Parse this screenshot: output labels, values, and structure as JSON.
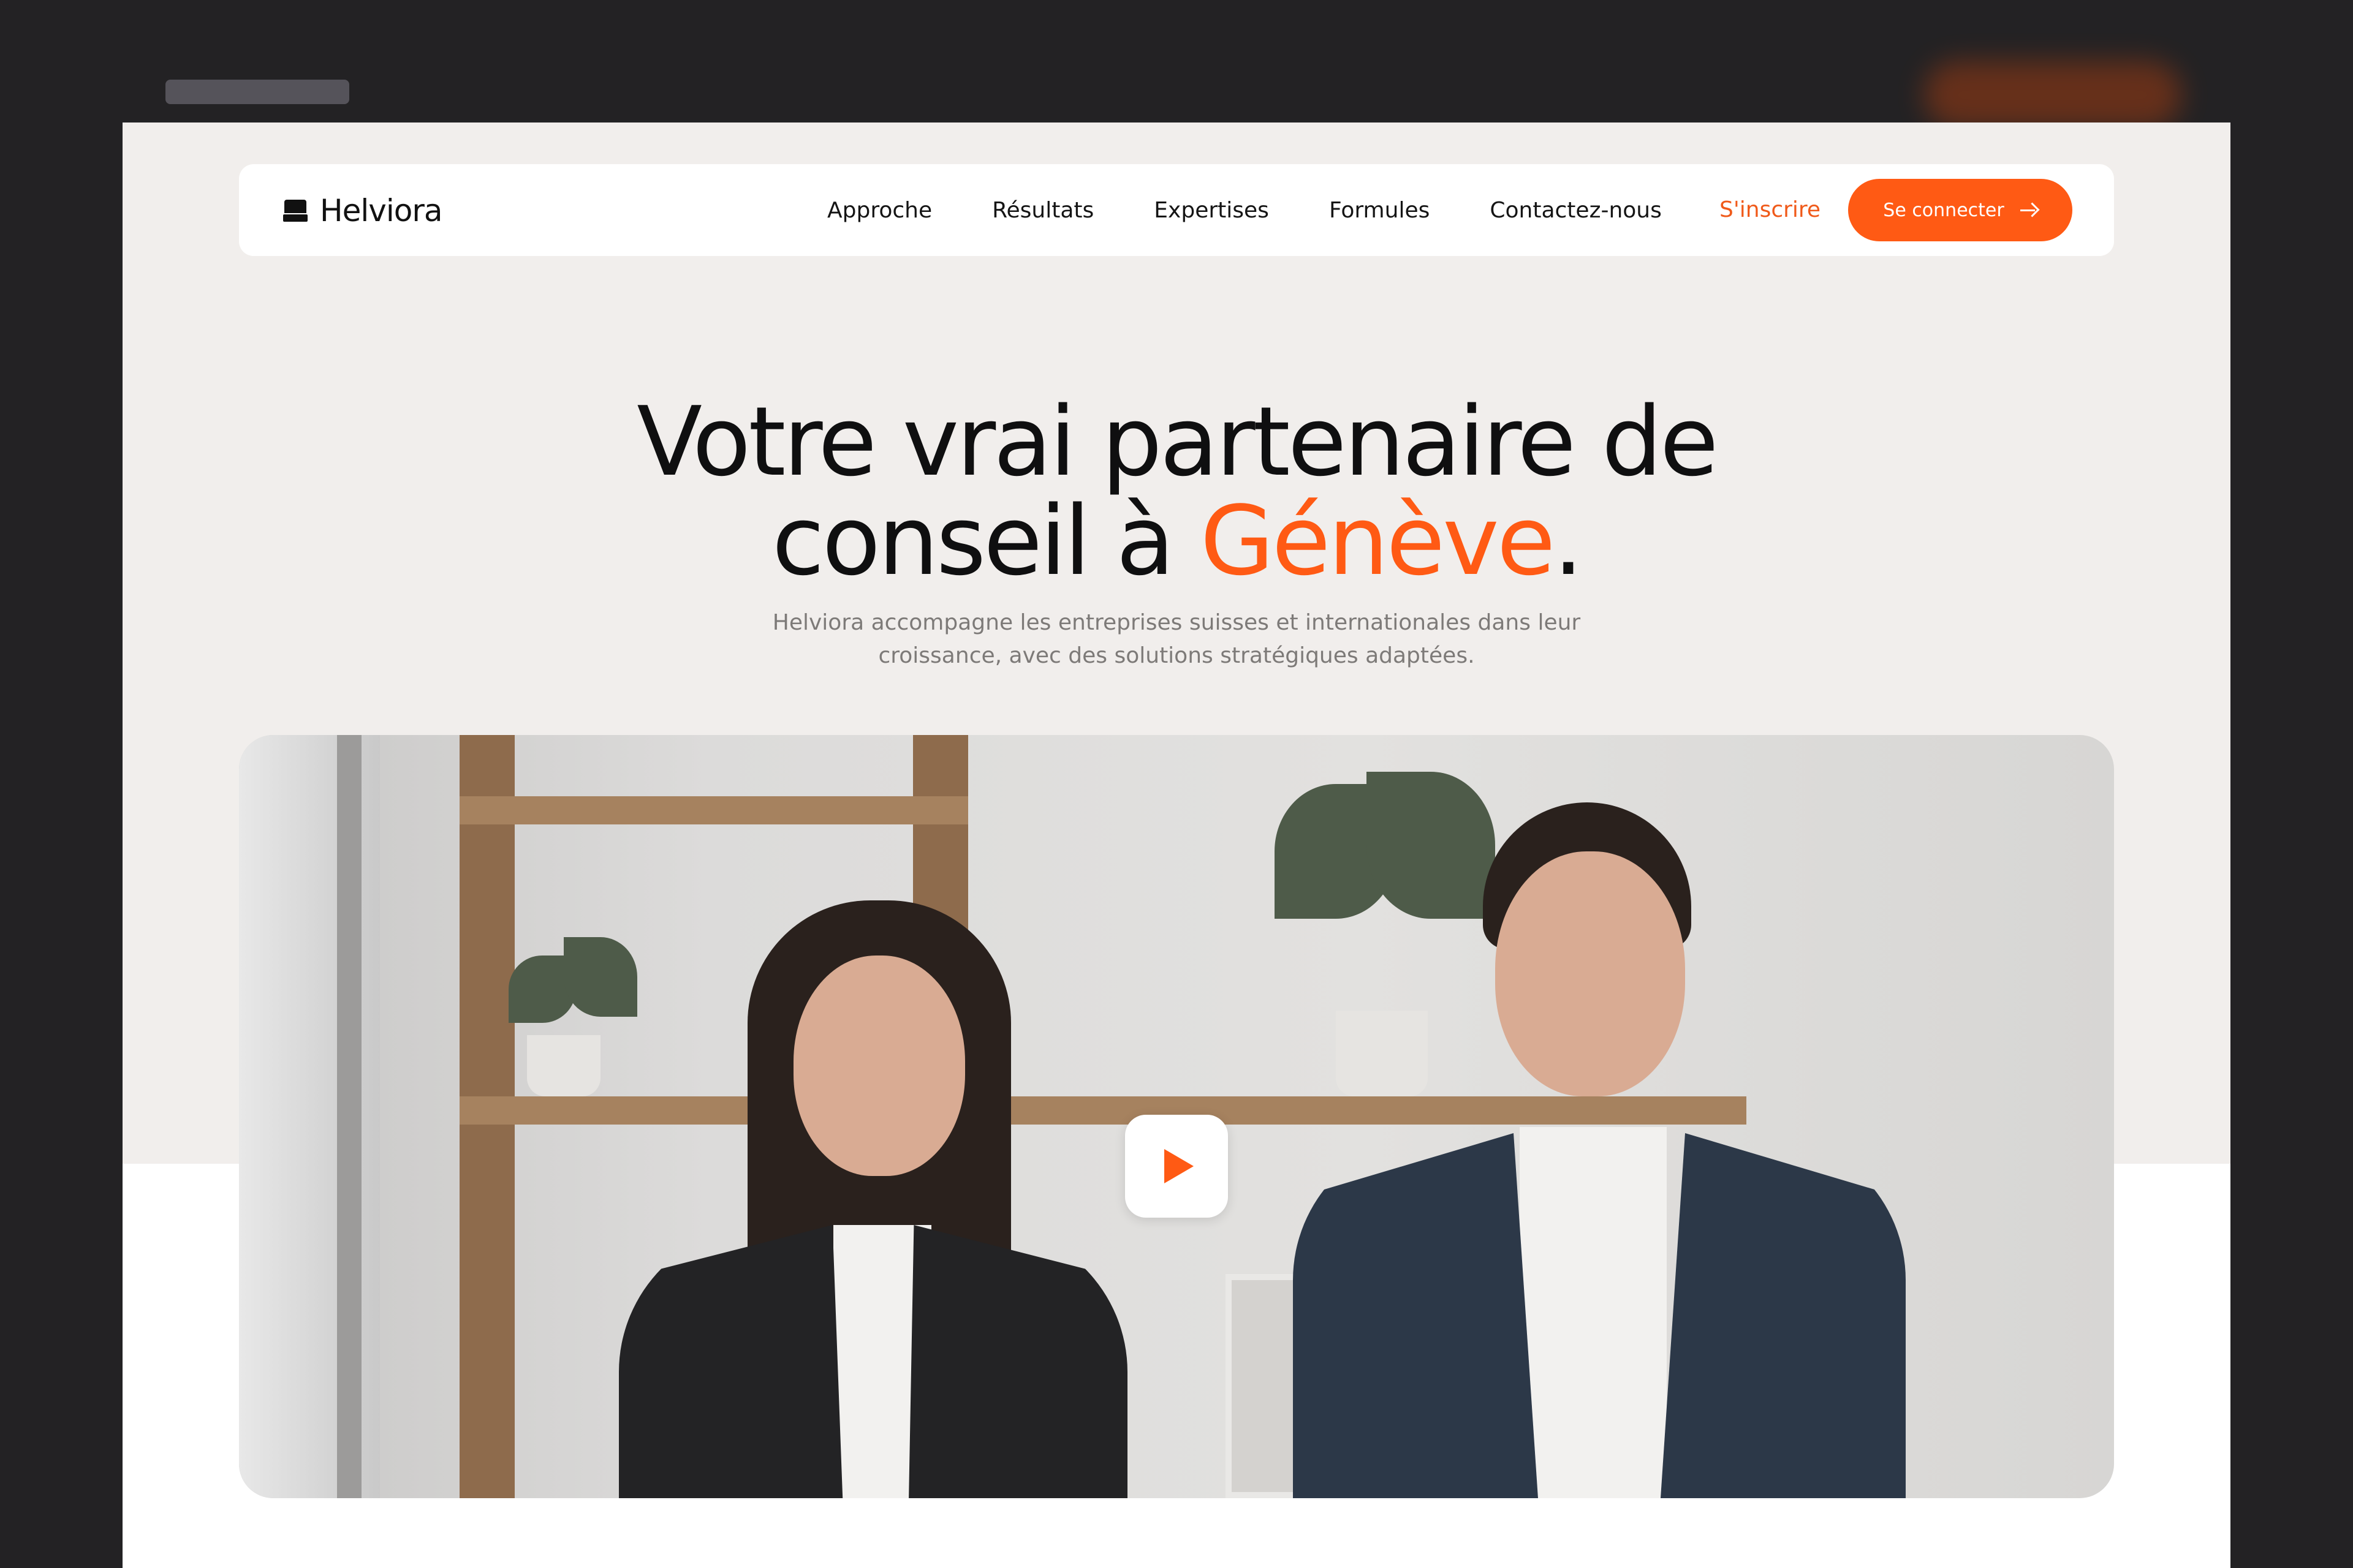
{
  "brand": {
    "name": "Helviora"
  },
  "nav": {
    "links": [
      "Approche",
      "Résultats",
      "Expertises",
      "Formules",
      "Contactez-nous"
    ],
    "signup_label": "S'inscrire",
    "login_label": "Se connecter"
  },
  "hero": {
    "headline_line1": "Votre vrai partenaire de",
    "headline_line2_pre": "conseil à ",
    "headline_accent": "Génève",
    "headline_line2_post": ".",
    "subtitle": "Helviora accompagne les entreprises suisses et internationales dans leur croissance, avec des solutions stratégiques adaptées."
  },
  "media": {
    "play_icon": "play-icon"
  },
  "colors": {
    "accent": "#ff5a14",
    "hero_bg": "#f1eeec",
    "text": "#0f0f10"
  }
}
